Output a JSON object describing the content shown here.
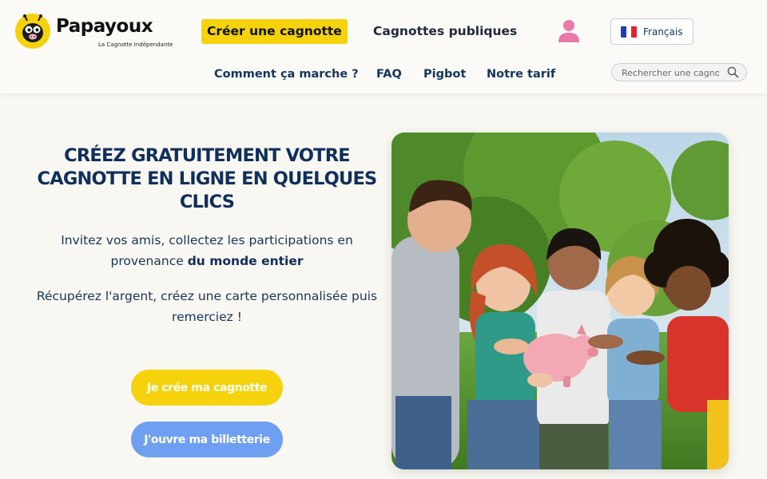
{
  "header": {
    "logo": {
      "name": "Papayoux",
      "tagline": "La Cagnotte Indépendante"
    },
    "cta_label": "Créer une cagnotte",
    "public_label": "Cagnottes publiques",
    "account_icon": "user-icon",
    "language": {
      "flag": "fr-flag",
      "selected": "Français"
    },
    "subnav": {
      "how": "Comment ça marche ?",
      "faq": "FAQ",
      "pigbot": "Pigbot",
      "pricing": "Notre tarif"
    },
    "search": {
      "placeholder": "Rechercher une cagnotte",
      "icon": "search-icon"
    }
  },
  "hero": {
    "title": "CRÉEZ GRATUITEMENT VOTRE CAGNOTTE EN LIGNE EN QUELQUES CLICS",
    "p1_text": "Invitez vos amis, collectez les participations en provenance",
    "p1_bold": "du monde entier",
    "p2_text": "Récupérez l'argent, créez une carte personnalisée puis remerciez !",
    "btn_create": "Je crée ma cagnotte",
    "btn_ticket": "J'ouvre ma billetterie"
  },
  "colors": {
    "accent_yellow": "#f5d20b",
    "navy": "#0f2f5c",
    "button_blue": "#6f9ff1",
    "account_pink": "#e879a8",
    "background": "#f9f7f1"
  }
}
